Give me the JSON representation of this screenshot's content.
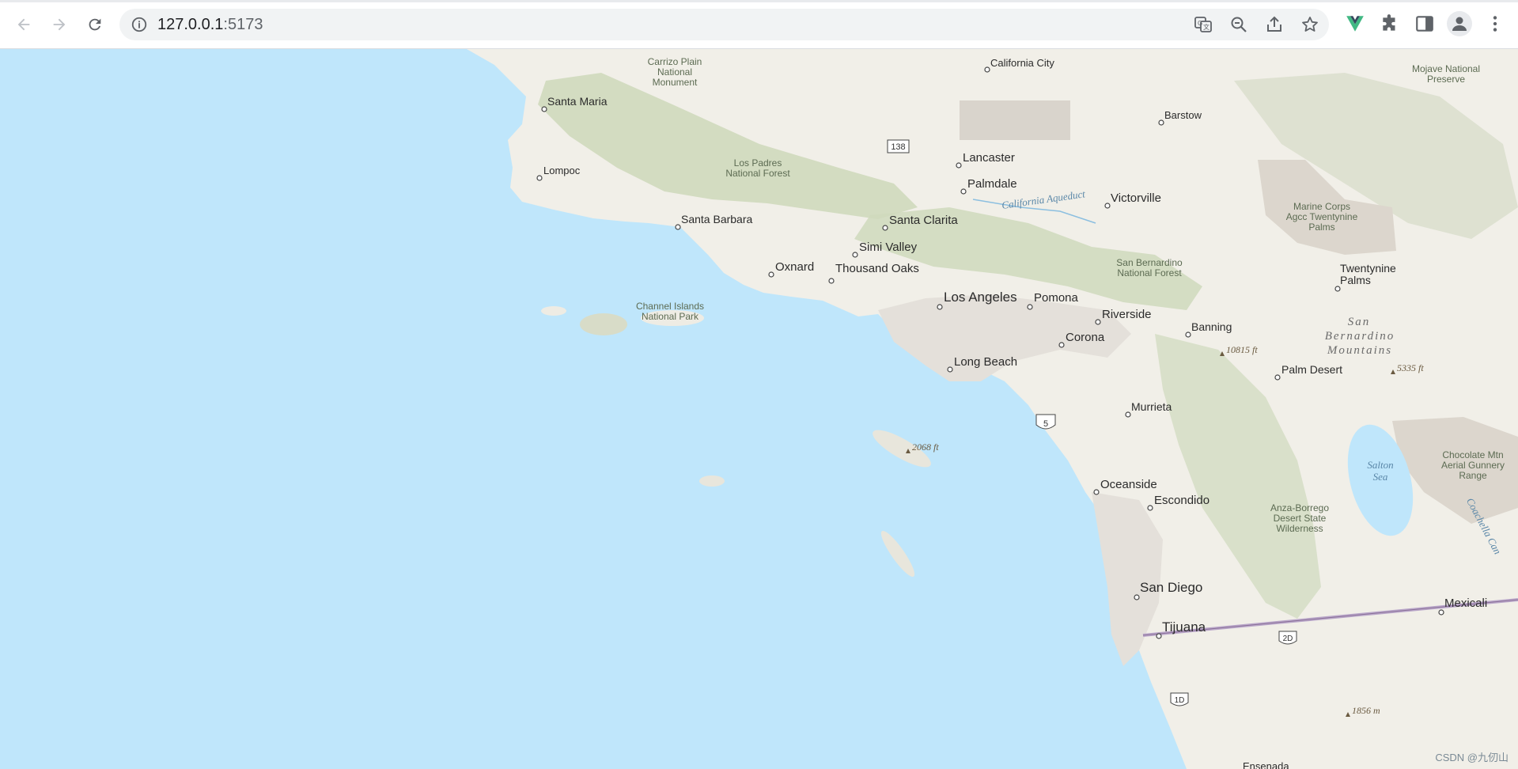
{
  "browser": {
    "url_host": "127.0.0.1",
    "url_port": ":5173",
    "icons": {
      "back": "back-arrow-icon",
      "forward": "forward-arrow-icon",
      "reload": "reload-icon",
      "info": "info-icon",
      "translate": "translate-icon",
      "zoom": "zoom-out-icon",
      "share": "share-icon",
      "bookmark": "star-icon",
      "vue_devtools": "vue-icon",
      "extensions": "puzzle-icon",
      "side_panel": "side-panel-icon",
      "profile": "profile-icon",
      "menu": "kebab-menu-icon"
    }
  },
  "map": {
    "cities": [
      {
        "name": "California City"
      },
      {
        "name": "Santa Maria"
      },
      {
        "name": "Barstow"
      },
      {
        "name": "Lancaster"
      },
      {
        "name": "Palmdale"
      },
      {
        "name": "Lompoc"
      },
      {
        "name": "Victorville"
      },
      {
        "name": "Santa Barbara"
      },
      {
        "name": "Santa Clarita"
      },
      {
        "name": "Simi Valley"
      },
      {
        "name": "Oxnard"
      },
      {
        "name": "Thousand Oaks"
      },
      {
        "name": "Twentynine"
      },
      {
        "name": "Palms"
      },
      {
        "name": "Los Angeles"
      },
      {
        "name": "Pomona"
      },
      {
        "name": "Riverside"
      },
      {
        "name": "Banning"
      },
      {
        "name": "Corona"
      },
      {
        "name": "Palm Desert"
      },
      {
        "name": "Long Beach"
      },
      {
        "name": "Murrieta"
      },
      {
        "name": "Oceanside"
      },
      {
        "name": "Escondido"
      },
      {
        "name": "San Diego"
      },
      {
        "name": "Tijuana"
      },
      {
        "name": "Mexicali"
      },
      {
        "name": "Ensenada"
      }
    ],
    "parks": [
      {
        "lines": [
          "Carrizo Plain",
          "National",
          "Monument"
        ]
      },
      {
        "lines": [
          "Mojave National",
          "Preserve"
        ]
      },
      {
        "lines": [
          "Los Padres",
          "National Forest"
        ]
      },
      {
        "lines": [
          "Marine Corps",
          "Agcc Twentynine",
          "Palms"
        ]
      },
      {
        "lines": [
          "San Bernardino",
          "National Forest"
        ]
      },
      {
        "lines": [
          "Channel Islands",
          "National Park"
        ]
      },
      {
        "lines": [
          "Chocolate Mtn",
          "Aerial Gunnery",
          "Range"
        ]
      },
      {
        "lines": [
          "Anza-Borrego",
          "Desert State",
          "Wilderness"
        ]
      }
    ],
    "water_labels": [
      {
        "text": "California Aqueduct"
      },
      {
        "text": "Salton"
      },
      {
        "text": "Sea"
      },
      {
        "text": "Coachella Can"
      }
    ],
    "mountain_labels": [
      {
        "text": "San"
      },
      {
        "text": "Bernardino"
      },
      {
        "text": "Mountains"
      }
    ],
    "elevations": [
      {
        "text": "10815 ft"
      },
      {
        "text": "5335 ft"
      },
      {
        "text": "2068 ft"
      },
      {
        "text": "1856 m"
      }
    ],
    "route_shields": [
      {
        "text": "138"
      },
      {
        "text": "5"
      },
      {
        "text": "2D"
      },
      {
        "text": "1D"
      }
    ],
    "attribution": "CSDN @九仞山",
    "colors": {
      "ocean": "#bfe6fb",
      "land": "#f1efe8",
      "forest": "#cdd8b8",
      "urban": "#e6e2dc",
      "border": "#b9a6c9"
    }
  }
}
